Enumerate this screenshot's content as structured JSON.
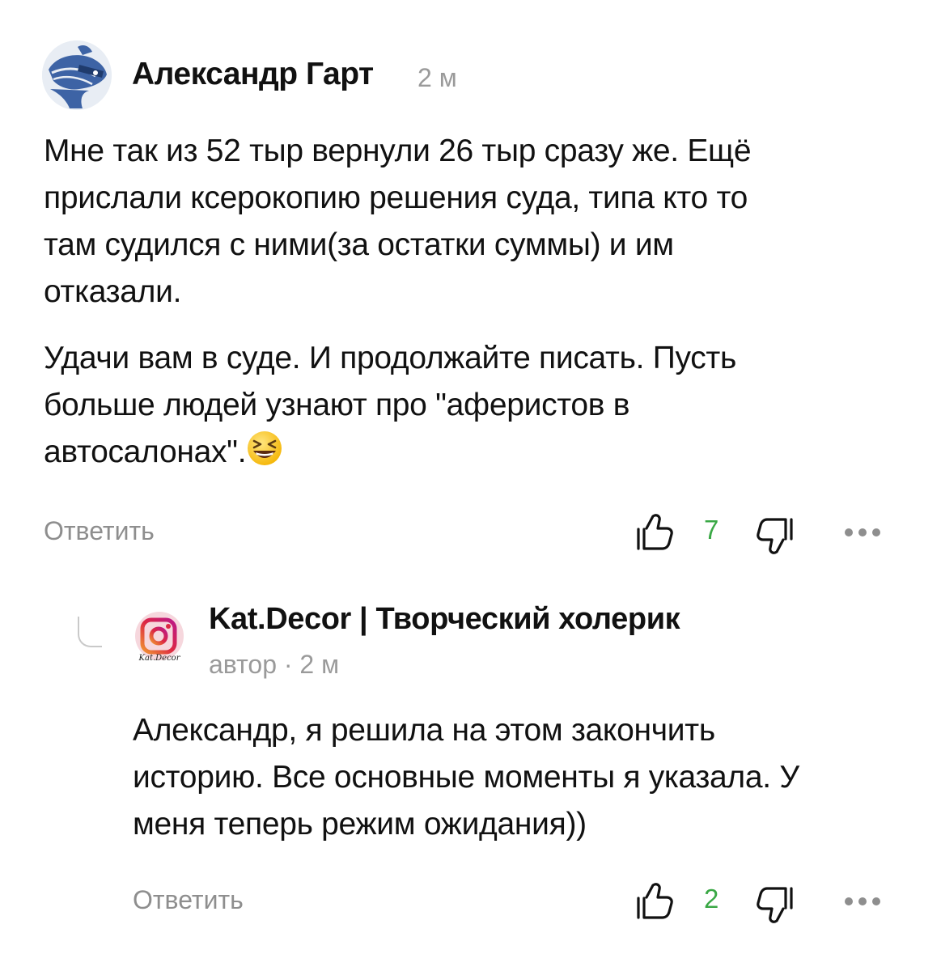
{
  "comment": {
    "author": "Александр Гарт",
    "time": "2 м",
    "paragraph1": [
      "Мне так из 52 тыр вернули 26 тыр сразу же. Ещё",
      "прислали ксерокопию решения суда, типа кто то",
      "там судился с ними(за остатки суммы) и им",
      "отказали."
    ],
    "paragraph2": [
      "Удачи вам в суде. И продолжайте писать. Пусть",
      "больше людей узнают про \"аферистов в",
      "автосалонах\"."
    ],
    "emoji": "laughing-face-emoji",
    "reply_label": "Ответить",
    "likes": "7"
  },
  "reply": {
    "author": "Kat.Decor | Творческий холерик",
    "meta": "автор · 2 м",
    "avatar_text": "Kat.Decor",
    "paragraph": [
      "Александр, я решила на этом закончить",
      "историю. Все основные моменты я указала. У",
      "меня теперь режим ожидания))"
    ],
    "reply_label": "Ответить",
    "likes": "2"
  },
  "colors": {
    "text": "#111111",
    "muted": "#8e8e8e",
    "like_count": "#3aa845",
    "avatar_bg": "#e8edf4",
    "avatar_fish": "#3d63a5",
    "instagram_pink": "#d63a6a"
  },
  "icons": {
    "like": "thumbs-up-icon",
    "dislike": "thumbs-down-icon",
    "more": "more-dots-icon",
    "thread": "thread-connector-icon"
  }
}
